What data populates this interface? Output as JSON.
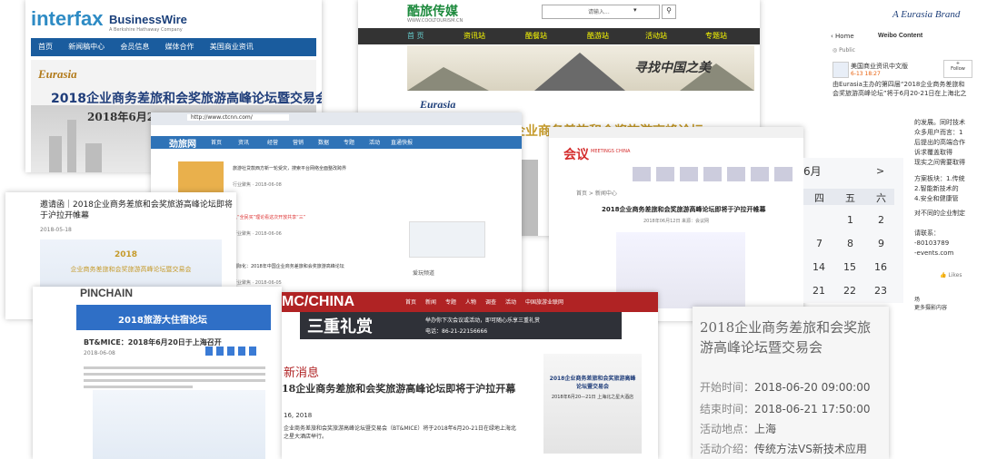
{
  "interfax": {
    "logo": "interfax",
    "partner_logo": "BusinessWire",
    "partner_tag": "A Berkshire Hathaway Company",
    "nav": [
      "首页",
      "新闻稿中心",
      "会员信息",
      "媒体合作",
      "美国商业资讯"
    ],
    "eurasia_logo": "Eurasia",
    "banner_title_cn": "2018企业商务差旅和会奖旅游高峰论坛暨交易会",
    "banner_date": "2018年6月20—"
  },
  "coolfeel": {
    "logo": "酷旅传媒",
    "url": "WWW.COOLTOURISM.CN",
    "search_placeholder": "请输入...",
    "nav": [
      "首 页",
      "资讯站",
      "酷餐站",
      "酷游站",
      "活动站",
      "专题站"
    ],
    "slogan": "寻找中国之美",
    "eurasia_logo": "Eurasia",
    "partial_title": "企业商务差旅和会奖旅游高峰论坛"
  },
  "jinglv": {
    "logo": "劲旅网",
    "url": "http://www.ctcnn.com/",
    "nav": [
      "首页",
      "资讯",
      "经营",
      "营销",
      "数据",
      "专题",
      "活动",
      "直通快报"
    ],
    "items": [
      {
        "title": "旅游社贷款西方新一轮受灾，搜索平台网络全面整改跨界",
        "meta": "行业聚焦 · 2018-06-08"
      },
      {
        "title": "从“全民买”理论看这次开放共享“三”",
        "meta": "行业聚焦 · 2018-06-06"
      },
      {
        "title": "国际化：2018年中国企业商务差旅和会奖旅游高峰论坛",
        "meta": "行业聚焦 · 2018-06-05"
      }
    ],
    "side_label": "爱玩频道"
  },
  "eventnote": {
    "title": "邀请函｜2018企业商务差旅和会奖旅游高峰论坛即将于沪拉开帷幕",
    "date": "2018-05-18",
    "poster_year": "2018",
    "poster_title": "企业商务差旅和会奖旅游高峰论坛暨交易会"
  },
  "huiyi": {
    "logo": "会议",
    "logo_en": "MEETINGS CHINA",
    "breadcrumb": "首页 > 新闻中心",
    "headline": "2018企业商务差旅和会奖旅游高峰论坛即将于沪拉开帷幕",
    "sub": "2018年06月12日 来源：会议网"
  },
  "pinchain": {
    "logo": "PINCHAIN",
    "banner": "2018旅游大住宿论坛",
    "headline": "BT&MICE：2018年6月20日于上海召开",
    "meta": "2018-06-08"
  },
  "mcchina": {
    "logo": "MC/CHINA",
    "nav": [
      "首页",
      "新闻",
      "专题",
      "人物",
      "调查",
      "活动",
      "中国旅游业联网"
    ],
    "banner_cn": "三重礼赏",
    "banner_sub": "举办你下次会议或活动，即可随心乐享三重礼赏",
    "phone": "电话：86-21-22156666",
    "section": "新消息",
    "headline": "18企业商务差旅和会奖旅游高峰论坛即将于沪拉开幕",
    "date": "16, 2018",
    "body": "企业商务差旅和会奖旅游高峰论坛暨交易会（BT&MICE）将于2018年6月20-21日在绿地上海北之星大酒店举行。",
    "poster_title": "2018企业商务差旅和会奖旅游高峰论坛暨交易会",
    "poster_date": "2018年6月20—21日 上海北之星大酒店"
  },
  "weibo": {
    "back": "Home",
    "header": "Weibo Content",
    "public": "Public",
    "account": "美国商业资讯中文版",
    "time": "6-13 18:27",
    "follow": "Follow",
    "text": "由Eurasia主办的第四届“2018企业商务差旅和会奖旅游高峰论坛”将于6月20-21日在上海北之星大酒店",
    "snippets": [
      "的发展。同时技术",
      "众多用户而言：1",
      "后提出的高端合作",
      "诉求覆盖取得",
      "现实之间需要取得"
    ],
    "list": [
      "方案板块：1.传统",
      "2.智能新技术的",
      "4.安全和健康管"
    ],
    "more": "对不同的企业制定",
    "contact_title": "请联系：",
    "contact_phone": "-80103789",
    "contact_web": "-events.com",
    "like": "Likes",
    "footer": [
      "场",
      "更多摄影内容"
    ],
    "brand": "A Eurasia Brand"
  },
  "calendar": {
    "month": "6月",
    "next": ">",
    "headers": [
      "四",
      "五",
      "六"
    ],
    "rows": [
      [
        "",
        "1",
        "2"
      ],
      [
        "7",
        "8",
        "9"
      ],
      [
        "14",
        "15",
        "16"
      ],
      [
        "21",
        "22",
        "23"
      ]
    ]
  },
  "event": {
    "title": "2018企业商务差旅和会奖旅游高峰论坛暨交易会",
    "start_label": "开始时间：",
    "start": "2018-06-20 09:00:00",
    "end_label": "结束时间：",
    "end": "2018-06-21 17:50:00",
    "place_label": "活动地点：",
    "place": "上海",
    "intro_label": "活动介绍：",
    "intro": "传统方法VS新技术应用"
  },
  "colors": {
    "interfax_blue": "#1a5c9e",
    "cool_dark": "#3a3a3a",
    "cool_accent": "#1d8a3d",
    "jinglv_blue": "#2f73b7",
    "mc_red": "#b02324",
    "calendar_blue": "#1e4fa0",
    "orange": "#e8600c"
  }
}
